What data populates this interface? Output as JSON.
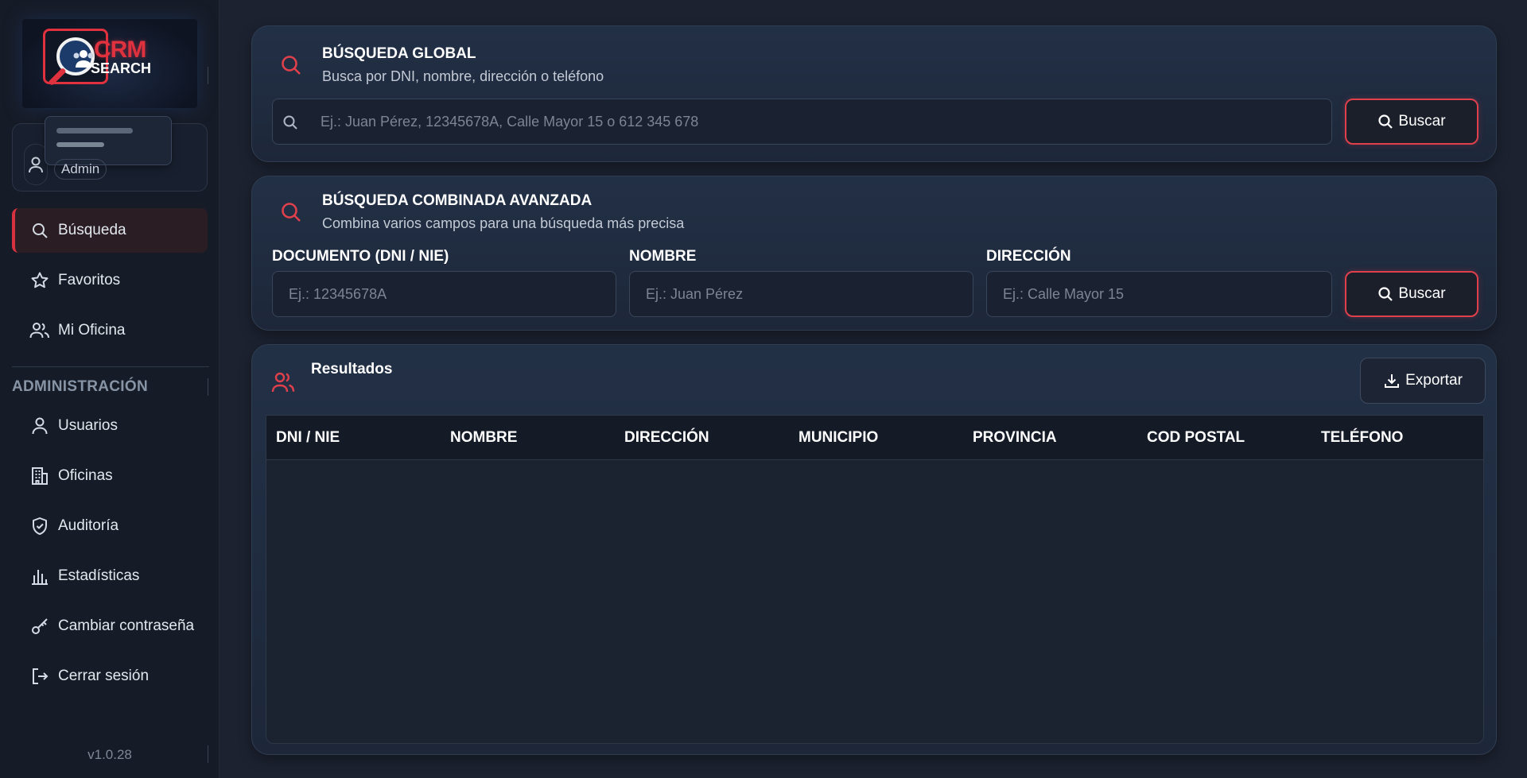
{
  "sidebar": {
    "logo": {
      "line1": "CRM",
      "line2": "SEARCH"
    },
    "user": {
      "role": "Admin"
    },
    "nav": [
      {
        "label": "Búsqueda",
        "icon": "search-icon",
        "active": true
      },
      {
        "label": "Favoritos",
        "icon": "star-icon",
        "active": false
      },
      {
        "label": "Mi Oficina",
        "icon": "users-icon",
        "active": false
      }
    ],
    "admin_section": "ADMINISTRACIÓN",
    "admin_nav": [
      {
        "label": "Usuarios",
        "icon": "user-icon"
      },
      {
        "label": "Oficinas",
        "icon": "building-icon"
      },
      {
        "label": "Auditoría",
        "icon": "shield-icon"
      },
      {
        "label": "Estadísticas",
        "icon": "bar-chart-icon"
      },
      {
        "label": "Cambiar contraseña",
        "icon": "key-icon"
      },
      {
        "label": "Cerrar sesión",
        "icon": "logout-icon"
      }
    ],
    "version": "v1.0.28"
  },
  "global_search": {
    "title": "BÚSQUEDA GLOBAL",
    "subtitle": "Busca por DNI, nombre, dirección o teléfono",
    "placeholder": "Ej.: Juan Pérez, 12345678A, Calle Mayor 15 o 612 345 678",
    "button": "Buscar"
  },
  "advanced_search": {
    "title": "BÚSQUEDA COMBINADA AVANZADA",
    "subtitle": "Combina varios campos para una búsqueda más precisa",
    "fields": [
      {
        "label": "DOCUMENTO (DNI / NIE)",
        "placeholder": "Ej.: 12345678A"
      },
      {
        "label": "NOMBRE",
        "placeholder": "Ej.: Juan Pérez"
      },
      {
        "label": "DIRECCIÓN",
        "placeholder": "Ej.: Calle Mayor 15"
      }
    ],
    "button": "Buscar"
  },
  "results": {
    "title": "Resultados",
    "export_button": "Exportar",
    "columns": [
      "DNI / NIE",
      "NOMBRE",
      "DIRECCIÓN",
      "MUNICIPIO",
      "PROVINCIA",
      "COD POSTAL",
      "TELÉFONO"
    ],
    "rows": []
  },
  "colors": {
    "accent": "#e0404c",
    "background": "#1c2230",
    "sidebar": "#161c27"
  }
}
